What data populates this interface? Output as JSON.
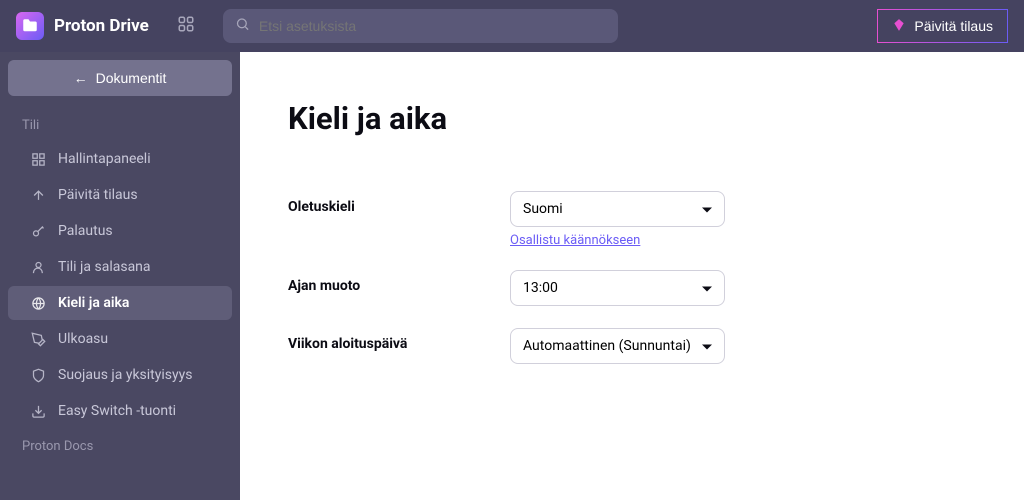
{
  "brand": {
    "name": "Proton Drive"
  },
  "search": {
    "placeholder": "Etsi asetuksista"
  },
  "upgrade": {
    "label": "Päivitä tilaus"
  },
  "back": {
    "label": "Dokumentit"
  },
  "sidebar": {
    "section1": "Tili",
    "items": [
      {
        "label": "Hallintapaneeli"
      },
      {
        "label": "Päivitä tilaus"
      },
      {
        "label": "Palautus"
      },
      {
        "label": "Tili ja salasana"
      },
      {
        "label": "Kieli ja aika"
      },
      {
        "label": "Ulkoasu"
      },
      {
        "label": "Suojaus ja yksityisyys"
      },
      {
        "label": "Easy Switch -tuonti"
      }
    ],
    "section2": "Proton Docs"
  },
  "page": {
    "title": "Kieli ja aika",
    "fields": {
      "language": {
        "label": "Oletuskieli",
        "value": "Suomi",
        "help": "Osallistu käännökseen"
      },
      "time": {
        "label": "Ajan muoto",
        "value": "13:00"
      },
      "week": {
        "label": "Viikon aloituspäivä",
        "value": "Automaattinen (Sunnuntai)"
      }
    }
  }
}
